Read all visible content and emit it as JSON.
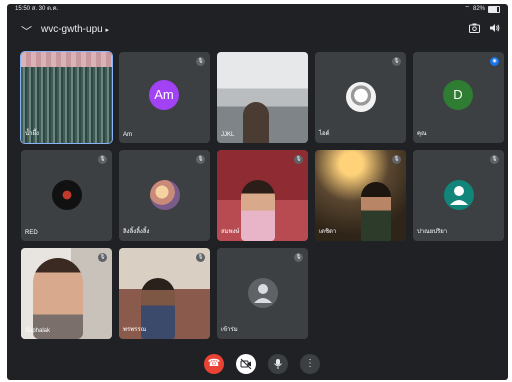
{
  "status": {
    "time": "15:50",
    "date": "ส. 30 ต.ค.",
    "battery": "82%"
  },
  "meeting": {
    "title": "wvc-gwth-upu"
  },
  "tiles": [
    {
      "name": "น้ำผึ้ง",
      "avatar": ""
    },
    {
      "name": "Am",
      "avatar": "Am"
    },
    {
      "name": "JJKL",
      "avatar": ""
    },
    {
      "name": "ไอด์",
      "avatar": ""
    },
    {
      "name": "คุณ",
      "avatar": "D"
    },
    {
      "name": "RED",
      "avatar": ""
    },
    {
      "name": "ลิงลิ้งลิ้งลิ้ง",
      "avatar": ""
    },
    {
      "name": "สมพงษ์",
      "avatar": ""
    },
    {
      "name": "เตชิตา",
      "avatar": ""
    },
    {
      "name": "ปาณยปริยา",
      "avatar": ""
    },
    {
      "name": "Suphalak",
      "avatar": ""
    },
    {
      "name": "พรพรรณ",
      "avatar": ""
    },
    {
      "name": "เข้าร่ม",
      "avatar": ""
    }
  ],
  "colors": {
    "am": "#a142f4",
    "d": "#2e7d32",
    "teal": "#12857a",
    "grey": "#9aa0a6",
    "end": "#ea4335"
  },
  "icons": {
    "mic": "mic-off-icon",
    "camera": "camera-off-icon",
    "more": "more-vert-icon"
  }
}
